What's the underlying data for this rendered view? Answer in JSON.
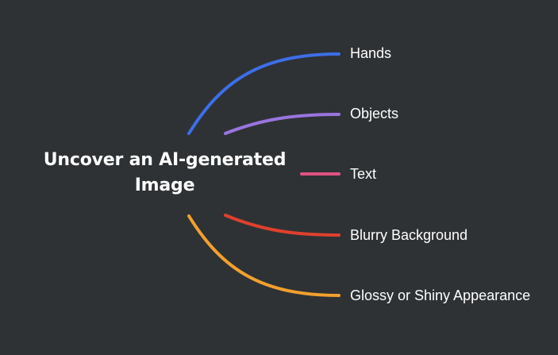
{
  "central_topic": {
    "line1": "Uncover an AI-generated",
    "line2": "Image"
  },
  "branches": [
    {
      "label": "Hands",
      "color": "#3e6ee8"
    },
    {
      "label": "Objects",
      "color": "#9a74e0"
    },
    {
      "label": "Text",
      "color": "#e0537f"
    },
    {
      "label": "Blurry Background",
      "color": "#e0402e"
    },
    {
      "label": "Glossy or Shiny Appearance",
      "color": "#f2a02e"
    }
  ]
}
